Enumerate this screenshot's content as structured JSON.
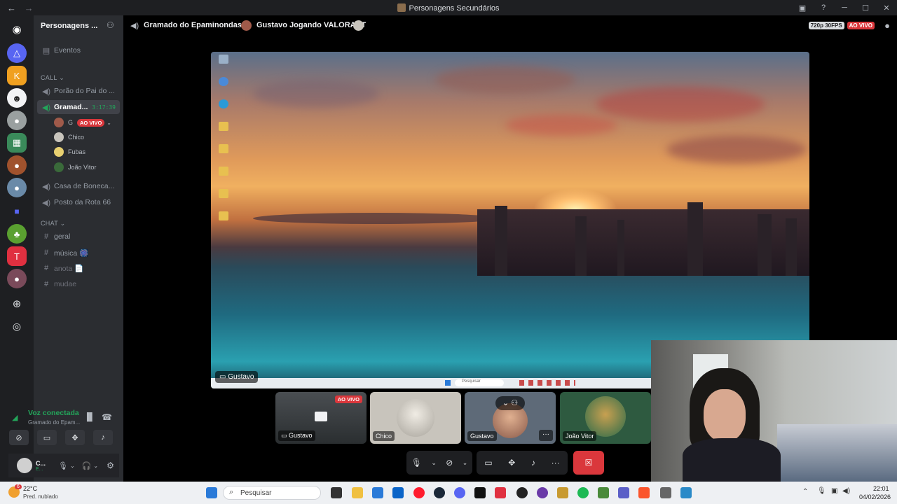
{
  "window": {
    "title": "Personagens Secundários",
    "back": "←",
    "forward": "→",
    "buttons": [
      "▣",
      "?",
      "─",
      "☐",
      "✕"
    ]
  },
  "server": {
    "name": "Personagens ...",
    "events": "Eventos"
  },
  "categories": {
    "call": "CALL",
    "chat": "CHAT"
  },
  "voice_channels": [
    {
      "name": "Porão do Pai do ..."
    },
    {
      "name": "Gramad...",
      "timer": "3:17:39"
    },
    {
      "name": "Casa de Boneca..."
    },
    {
      "name": "Posto da Rota 66"
    }
  ],
  "members": [
    {
      "name": "G",
      "live": "AO VIVO"
    },
    {
      "name": "Chico"
    },
    {
      "name": "Fubas"
    },
    {
      "name": "João Vitor"
    }
  ],
  "text_channels": [
    {
      "name": "geral"
    },
    {
      "name": "música 🎆"
    },
    {
      "name": "anota 📄"
    },
    {
      "name": "mudae"
    }
  ],
  "voice_panel": {
    "status": "Voz conectada",
    "channel": "Gramado do Epam..."
  },
  "user": {
    "name": "C...",
    "status": "E..."
  },
  "topbar": {
    "channel": "Gramado do Epaminondas",
    "stream": "Gustavo Jogando VALORANT",
    "quality": "720p 30FPS",
    "live": "AO VIVO"
  },
  "stream_view": {
    "name": "Gustavo",
    "search": "Pesquisar"
  },
  "tiles": [
    {
      "name": "Gustavo",
      "live": "AO VIVO"
    },
    {
      "name": "Chico"
    },
    {
      "name": "Gustavo"
    },
    {
      "name": "João Vitor"
    }
  ],
  "taskbar": {
    "temp": "22°C",
    "weather": "Pred. nublado",
    "search": "Pesquisar",
    "time": "22:01",
    "date": "04/02/2026",
    "notif_count": "6"
  }
}
